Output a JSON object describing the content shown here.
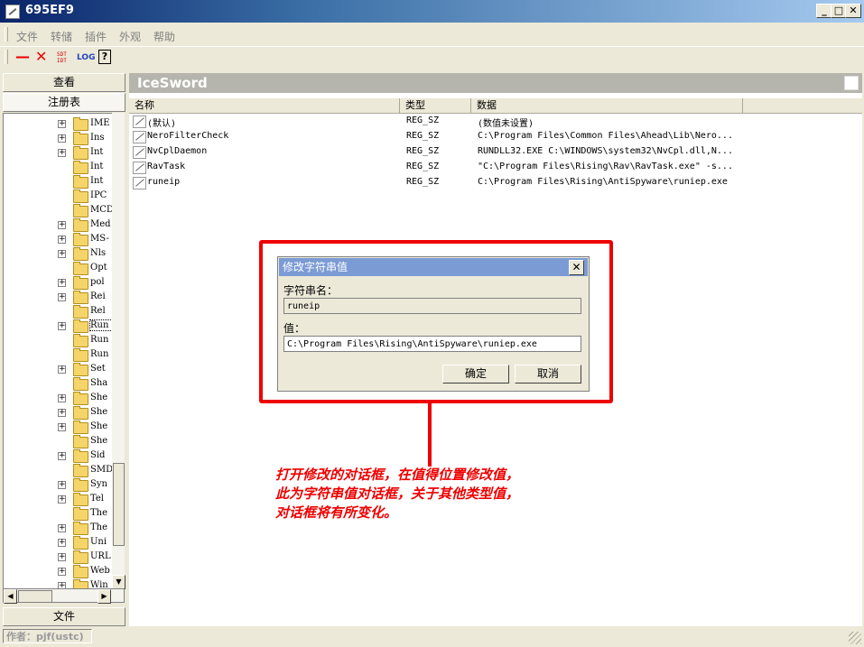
{
  "window": {
    "title": "695EF9",
    "min": "_",
    "max": "□",
    "close": "✕"
  },
  "menu": [
    "文件",
    "转储",
    "插件",
    "外观",
    "帮助"
  ],
  "toolbar": {
    "minus": "—",
    "close": "✕",
    "sdt": "SDT\nIDT",
    "log": "LOG",
    "help": "?"
  },
  "left_panel": {
    "tab_view": "查看",
    "tab_registry": "注册表",
    "tab_file": "文件",
    "tree": [
      {
        "label": "IME",
        "exp": true
      },
      {
        "label": "Ins",
        "exp": true
      },
      {
        "label": "Int",
        "exp": true
      },
      {
        "label": "Int",
        "exp": false
      },
      {
        "label": "Int",
        "exp": false
      },
      {
        "label": "IPC",
        "exp": false
      },
      {
        "label": "MCD",
        "exp": false
      },
      {
        "label": "Med",
        "exp": true
      },
      {
        "label": "MS-",
        "exp": true
      },
      {
        "label": "Nls",
        "exp": true
      },
      {
        "label": "Opt",
        "exp": false
      },
      {
        "label": "pol",
        "exp": true
      },
      {
        "label": "Rei",
        "exp": true
      },
      {
        "label": "Rel",
        "exp": false
      },
      {
        "label": "Run",
        "exp": true,
        "selected": true
      },
      {
        "label": "Run",
        "exp": false
      },
      {
        "label": "Run",
        "exp": false
      },
      {
        "label": "Set",
        "exp": true
      },
      {
        "label": "Sha",
        "exp": false
      },
      {
        "label": "She",
        "exp": true
      },
      {
        "label": "She",
        "exp": true
      },
      {
        "label": "She",
        "exp": true
      },
      {
        "label": "She",
        "exp": false
      },
      {
        "label": "Sid",
        "exp": true
      },
      {
        "label": "SMD",
        "exp": false
      },
      {
        "label": "Syn",
        "exp": true
      },
      {
        "label": "Tel",
        "exp": true
      },
      {
        "label": "The",
        "exp": false
      },
      {
        "label": "The",
        "exp": true
      },
      {
        "label": "Uni",
        "exp": true
      },
      {
        "label": "URL",
        "exp": true
      },
      {
        "label": "Web",
        "exp": true
      },
      {
        "label": "Win",
        "exp": true
      }
    ]
  },
  "right_panel": {
    "header": "IceSword",
    "columns": [
      "名称",
      "类型",
      "数据"
    ],
    "rows": [
      {
        "name": "(默认)",
        "type": "REG_SZ",
        "data": "(数值未设置)"
      },
      {
        "name": "NeroFilterCheck",
        "type": "REG_SZ",
        "data": "C:\\Program Files\\Common Files\\Ahead\\Lib\\Nero..."
      },
      {
        "name": "NvCplDaemon",
        "type": "REG_SZ",
        "data": "RUNDLL32.EXE C:\\WINDOWS\\system32\\NvCpl.dll,N..."
      },
      {
        "name": "RavTask",
        "type": "REG_SZ",
        "data": "\"C:\\Program Files\\Rising\\Rav\\RavTask.exe\" -s..."
      },
      {
        "name": "runeip",
        "type": "REG_SZ",
        "data": "C:\\Program Files\\Rising\\AntiSpyware\\runiep.exe"
      }
    ]
  },
  "dialog": {
    "title": "修改字符串值",
    "close": "✕",
    "name_label": "字符串名：",
    "name_value": "runeip",
    "value_label": "值：",
    "value_value": "C:\\Program Files\\Rising\\AntiSpyware\\runiep.exe",
    "ok": "确定",
    "cancel": "取消"
  },
  "annotation": [
    "打开修改的对话框，在值得位置修改值，",
    "此为字符串值对话框，关于其他类型值，",
    "对话框将有所变化。"
  ],
  "status": {
    "author": "作者：pjf(ustc)"
  },
  "colors": {
    "highlight": "#ee0000",
    "dialog_title": "#7b9bd4",
    "panel_header": "#b5b5ad"
  }
}
